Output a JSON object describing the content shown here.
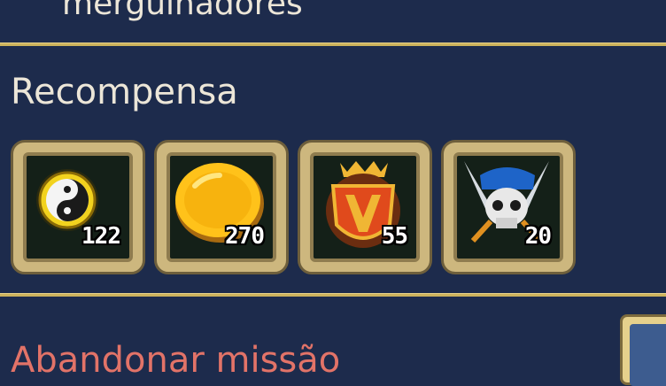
{
  "previous_line": "mergulhadores",
  "rewards_section": {
    "title": "Recompensa",
    "items": [
      {
        "icon": "yin-yang-orb-icon",
        "count": "122"
      },
      {
        "icon": "gold-coin-icon",
        "count": "270"
      },
      {
        "icon": "crest-shield-icon",
        "count": "55"
      },
      {
        "icon": "pirate-skull-icon",
        "count": "20"
      }
    ]
  },
  "abandon_label": "Abandonar missão",
  "colors": {
    "background": "#1d2b4c",
    "divider": "#cdb35c",
    "text": "#ece6d8",
    "danger_text": "#e27368"
  }
}
